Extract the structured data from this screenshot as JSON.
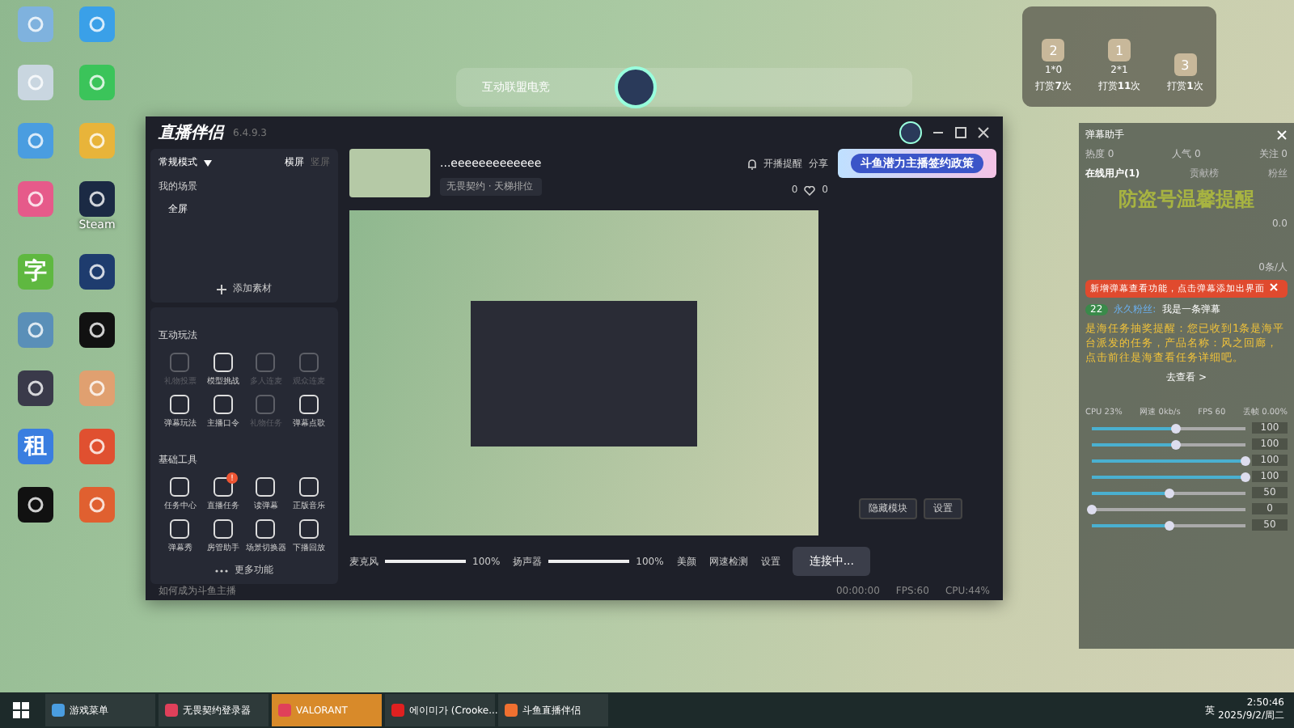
{
  "desktop_icons": [
    {
      "kind": "monitor"
    },
    {
      "kind": "penguin"
    },
    {
      "kind": "bin"
    },
    {
      "kind": "chat"
    },
    {
      "kind": "cloud"
    },
    {
      "kind": "cat"
    },
    {
      "kind": "pinwheel"
    },
    {
      "kind": "steam",
      "label": "Steam"
    },
    {
      "kind": "glyph",
      "glyph": "字"
    },
    {
      "kind": "ring"
    },
    {
      "kind": "drive"
    },
    {
      "kind": "note"
    },
    {
      "kind": "tablet"
    },
    {
      "kind": "person"
    },
    {
      "kind": "glyph",
      "glyph": "租"
    },
    {
      "kind": "windows"
    },
    {
      "kind": "logi"
    },
    {
      "kind": "bird"
    }
  ],
  "top_widget": {
    "title": "互动联盟电竞"
  },
  "gift_ranking": [
    {
      "rank": "2",
      "score": "1*0",
      "caption": "打赏",
      "count": "7",
      "unit": "次"
    },
    {
      "rank": "1",
      "score": "2*1",
      "caption": "打赏",
      "count": "11",
      "unit": "次"
    },
    {
      "rank": "3",
      "caption": "打赏",
      "count": "1",
      "unit": "次"
    }
  ],
  "window": {
    "title": "直播伴侣",
    "version": "6.4.9.3",
    "mode": "常规模式",
    "orientations": [
      {
        "label": "横屏",
        "selected": true
      },
      {
        "label": "竖屏",
        "selected": false
      }
    ],
    "scenes_label": "我的场景",
    "scenes": [
      {
        "label": "全屏"
      }
    ],
    "add_source": "添加素材",
    "sections": [
      {
        "title": "互动玩法",
        "tools": [
          {
            "label": "礼物投票",
            "disabled": true
          },
          {
            "label": "模型挑战",
            "disabled": false
          },
          {
            "label": "多人连麦",
            "disabled": true
          },
          {
            "label": "观众连麦",
            "disabled": true
          },
          {
            "label": "弹幕玩法",
            "disabled": false
          },
          {
            "label": "主播口令",
            "disabled": false
          },
          {
            "label": "礼物任务",
            "disabled": true
          },
          {
            "label": "弹幕点歌",
            "disabled": false
          }
        ]
      },
      {
        "title": "基础工具",
        "tools": [
          {
            "label": "任务中心",
            "disabled": false
          },
          {
            "label": "直播任务",
            "disabled": false,
            "badge": "!"
          },
          {
            "label": "读弹幕",
            "disabled": false
          },
          {
            "label": "正版音乐",
            "disabled": false
          },
          {
            "label": "弹幕秀",
            "disabled": false
          },
          {
            "label": "房管助手",
            "disabled": false
          },
          {
            "label": "场景切换器",
            "disabled": false
          },
          {
            "label": "下播回放",
            "disabled": false
          }
        ]
      }
    ],
    "more": "更多功能",
    "stream_title": "...eeeeeeeeeeeee",
    "category": "无畏契约 · 天梯排位",
    "reminder": "开播提醒",
    "share": "分享",
    "banner": "斗鱼潜力主播签约政策",
    "likes": "0",
    "hearts": "0",
    "audio": [
      {
        "label": "麦克风",
        "level": 1,
        "reading": "100%"
      },
      {
        "label": "扬声器",
        "level": 1,
        "reading": "100%"
      }
    ],
    "controls": [
      {
        "label": "美颜"
      },
      {
        "label": "网速检测"
      },
      {
        "label": "设置"
      }
    ],
    "start_button": "连接中...",
    "side_buttons": [
      "隐藏模块",
      "设置"
    ],
    "status": {
      "help": "如何成为斗鱼主播",
      "timer": "00:00:00",
      "fps": "FPS:60",
      "cpu": "CPU:44%"
    }
  },
  "danmu": {
    "title": "弹幕助手",
    "stats": [
      "热度 0",
      "人气 0",
      "关注 0"
    ],
    "tabs": [
      {
        "label": "在线用户(1)",
        "selected": true
      },
      {
        "label": "贡献榜",
        "selected": false
      },
      {
        "label": "粉丝",
        "selected": false
      }
    ],
    "watermark": "防盗号温馨提醒",
    "score": "0.0",
    "rate": "0条/人",
    "notice": "新增弹幕查看功能，点击弹幕添加出界面",
    "badge": "22",
    "sender": "永久粉丝:",
    "message": "我是一条弹幕",
    "task": "是海任务抽奖提醒：您已收到1条是海平台派发的任务，产品名称：风之回廊，点击前往是海查看任务详细吧。",
    "task_link": "去查看 >",
    "perf": [
      "CPU 23%",
      "网速 0kb/s",
      "FPS 60",
      "丢帧 0.00%"
    ],
    "sliders": [
      {
        "level": 0.55,
        "reading": "100"
      },
      {
        "level": 0.55,
        "reading": "100"
      },
      {
        "level": 1,
        "reading": "100"
      },
      {
        "level": 1,
        "reading": "100"
      },
      {
        "level": 0.5,
        "reading": "50"
      },
      {
        "level": 0,
        "reading": "0"
      },
      {
        "level": 0.5,
        "reading": "50"
      }
    ]
  },
  "taskbar": {
    "items": [
      {
        "label": "游戏菜单",
        "kind": "cloud",
        "selected": false
      },
      {
        "label": "无畏契约登录器",
        "kind": "v",
        "selected": false
      },
      {
        "label": "VALORANT",
        "kind": "v",
        "selected": true
      },
      {
        "label": "에이미가 (Crooke...",
        "kind": "netease",
        "selected": false
      },
      {
        "label": "斗鱼直播伴侣",
        "kind": "douyu",
        "selected": false
      }
    ],
    "ime": "英",
    "time": "2:50:46",
    "date": "2025/9/2/周二"
  }
}
